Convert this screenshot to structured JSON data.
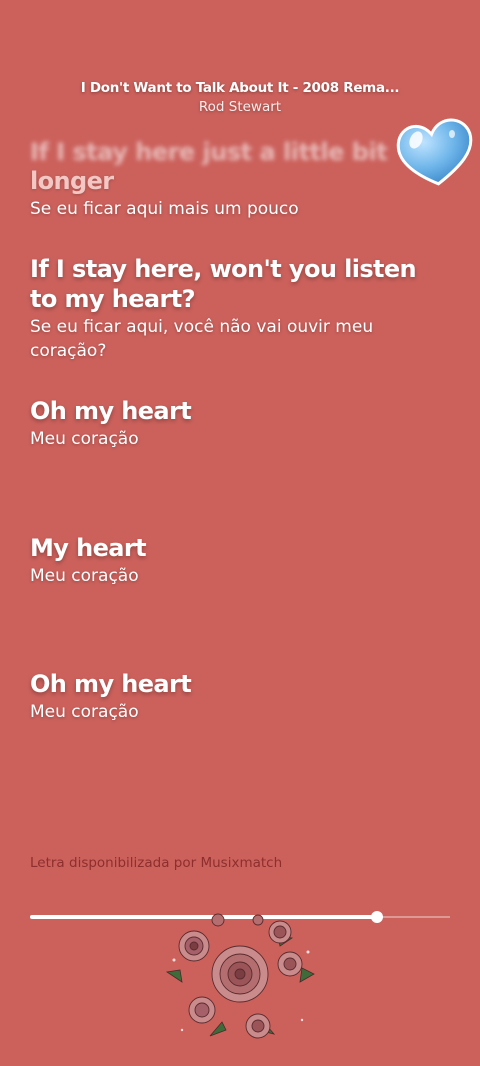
{
  "header": {
    "song_title": "I Don't Want to Talk About It - 2008 Rema...",
    "artist": "Rod Stewart"
  },
  "lyrics": [
    {
      "original_partial": "If I stay here just a little bit",
      "original": "longer",
      "translation": "Se eu ficar aqui mais um pouco",
      "state": "past"
    },
    {
      "original": "If I stay here, won't you listen to my heart?",
      "translation": "Se eu ficar aqui, você não vai ouvir meu coração?",
      "state": "active"
    },
    {
      "original": "Oh my heart",
      "translation": "Meu coração",
      "state": "upcoming"
    },
    {
      "original": "My heart",
      "translation": "Meu coração",
      "state": "upcoming"
    },
    {
      "original": "Oh my heart",
      "translation": "Meu coração",
      "state": "upcoming"
    }
  ],
  "credit": "Letra disponibilizada por Musixmatch",
  "playback": {
    "progress": 0.825
  },
  "stickers": {
    "top": "blue-heart",
    "bottom": "rose-bouquet"
  },
  "colors": {
    "background": "#cc615c",
    "heart": "#6fb6ea",
    "credit": "#8c2f2e"
  }
}
